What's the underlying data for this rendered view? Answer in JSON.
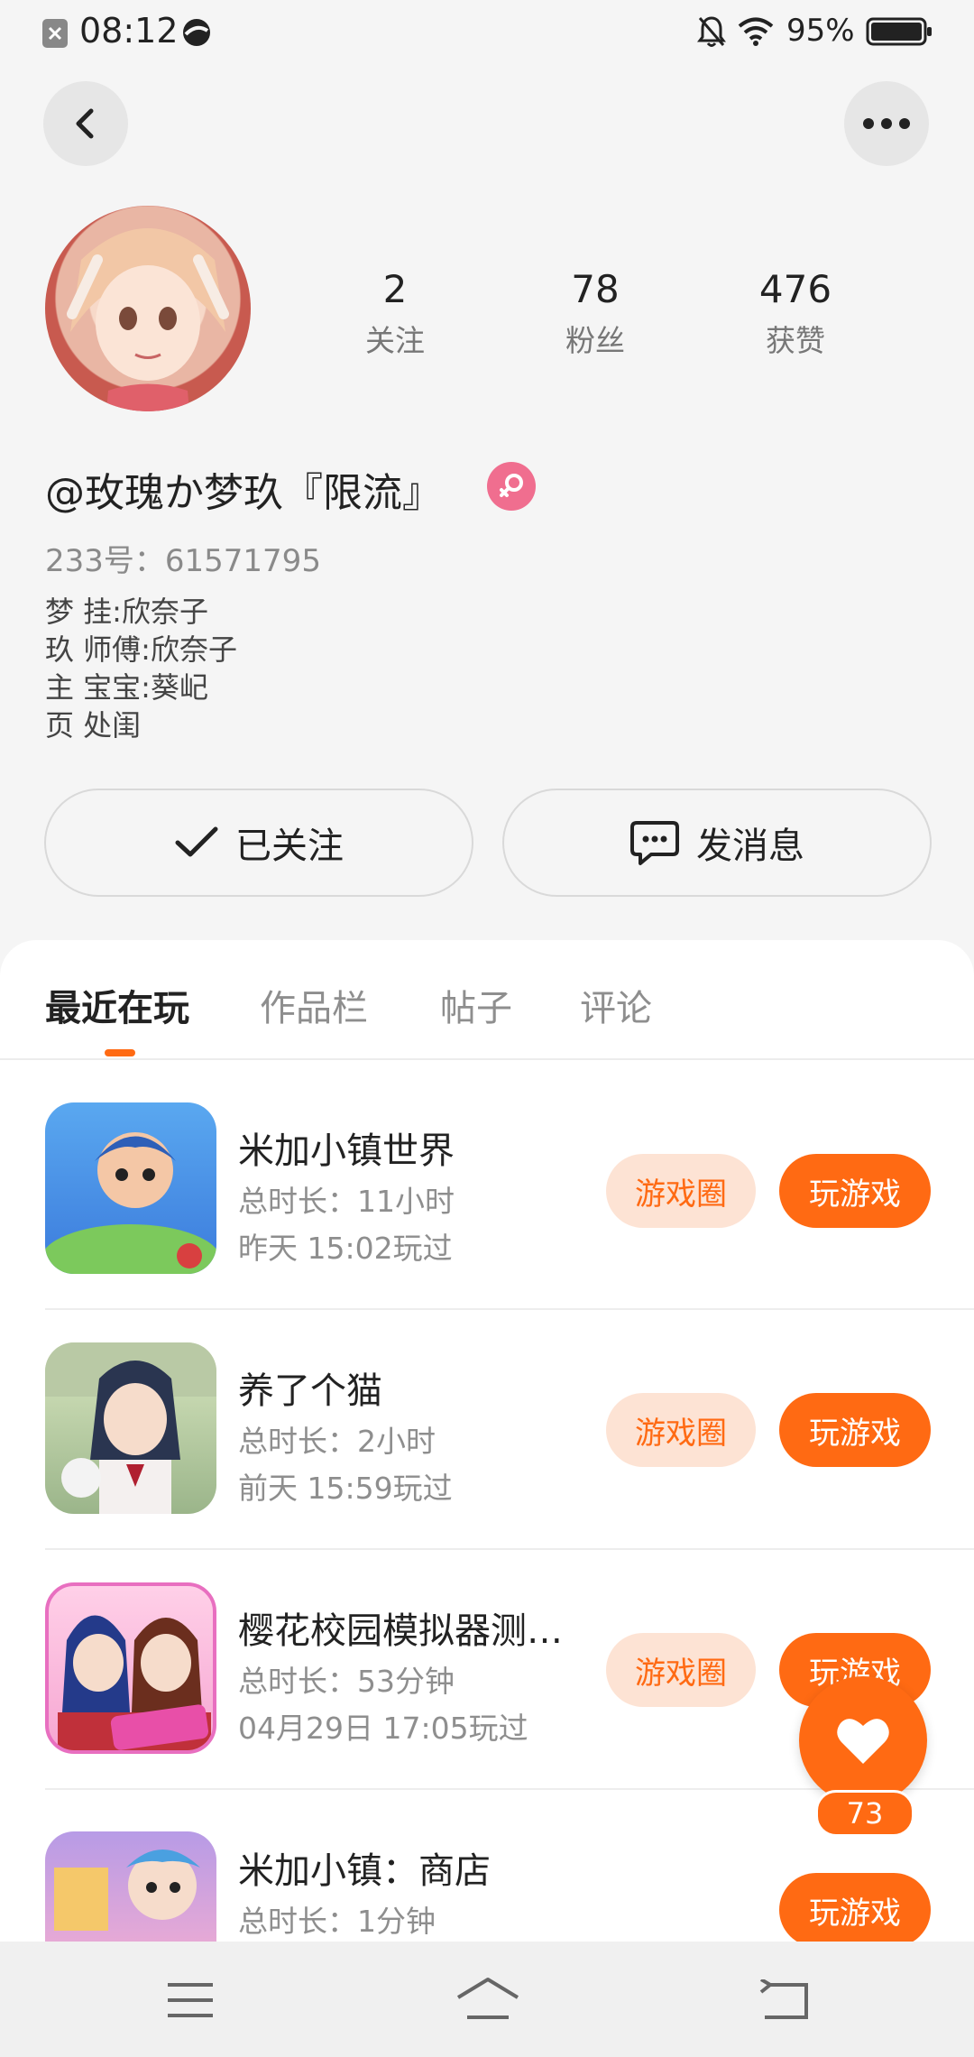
{
  "status": {
    "time": "08:12",
    "battery": "95%"
  },
  "profile": {
    "stats": [
      {
        "value": "2",
        "label": "关注"
      },
      {
        "value": "78",
        "label": "粉丝"
      },
      {
        "value": "476",
        "label": "获赞"
      }
    ],
    "name": "@玫瑰か梦玖『限流』",
    "uid": "233号：61571795",
    "bio": [
      "梦 挂:欣奈子",
      "玖 师傅:欣奈子",
      "主 宝宝:葵屺",
      "页 处闺"
    ]
  },
  "actions": {
    "followed": "已关注",
    "message": "发消息"
  },
  "tabs": [
    "最近在玩",
    "作品栏",
    "帖子",
    "评论"
  ],
  "games": [
    {
      "title": "米加小镇世界",
      "duration": "总时长：11小时",
      "last_played": "昨天 15:02玩过",
      "circle": "游戏圈",
      "play": "玩游戏"
    },
    {
      "title": "养了个猫",
      "duration": "总时长：2小时",
      "last_played": "前天 15:59玩过",
      "circle": "游戏圈",
      "play": "玩游戏"
    },
    {
      "title": "樱花校园模拟器测…",
      "duration": "总时长：53分钟",
      "last_played": "04月29日 17:05玩过",
      "circle": "游戏圈",
      "play": "玩游戏"
    },
    {
      "title": "米加小镇：商店",
      "duration": "总时长：1分钟",
      "last_played": "",
      "circle": "",
      "play": "玩游戏"
    }
  ],
  "like_count": "73",
  "colors": {
    "accent": "#ff6a13",
    "accent_light": "#fde3d4"
  }
}
